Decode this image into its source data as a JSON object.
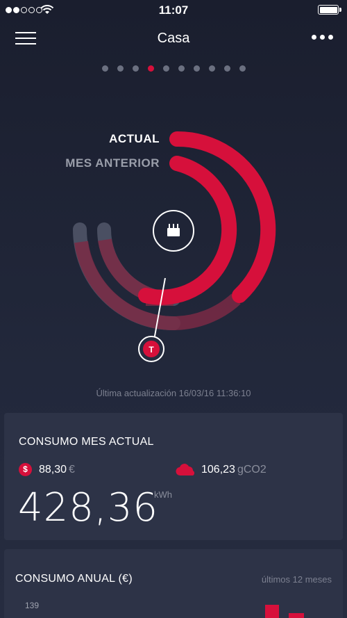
{
  "status_bar": {
    "time": "11:07",
    "signal_bars": 2,
    "signal_total": 5
  },
  "header": {
    "title": "Casa",
    "menu_icon": "hamburger-icon",
    "more_icon": "more-dots-icon"
  },
  "pager": {
    "total": 10,
    "active_index": 3
  },
  "gauge": {
    "label_current": "ACTUAL",
    "label_previous": "MES ANTERIOR",
    "center_icon": "router-icon",
    "marker_letter": "T",
    "colors": {
      "accent": "#d6103b",
      "track": "#4a4f62"
    }
  },
  "last_update": "Última actualización 16/03/16 11:36:10",
  "current_month": {
    "title": "CONSUMO MES ACTUAL",
    "cost_icon_symbol": "$",
    "cost_value": "88,30",
    "cost_unit": "€",
    "co2_icon": "cloud-icon",
    "co2_value": "106,23",
    "co2_unit": "gCO2",
    "energy_value": "428,36",
    "energy_unit": "kWh"
  },
  "annual": {
    "title": "CONSUMO ANUAL (€)",
    "range_label": "últimos 12 meses",
    "axis_max_label": "139"
  }
}
